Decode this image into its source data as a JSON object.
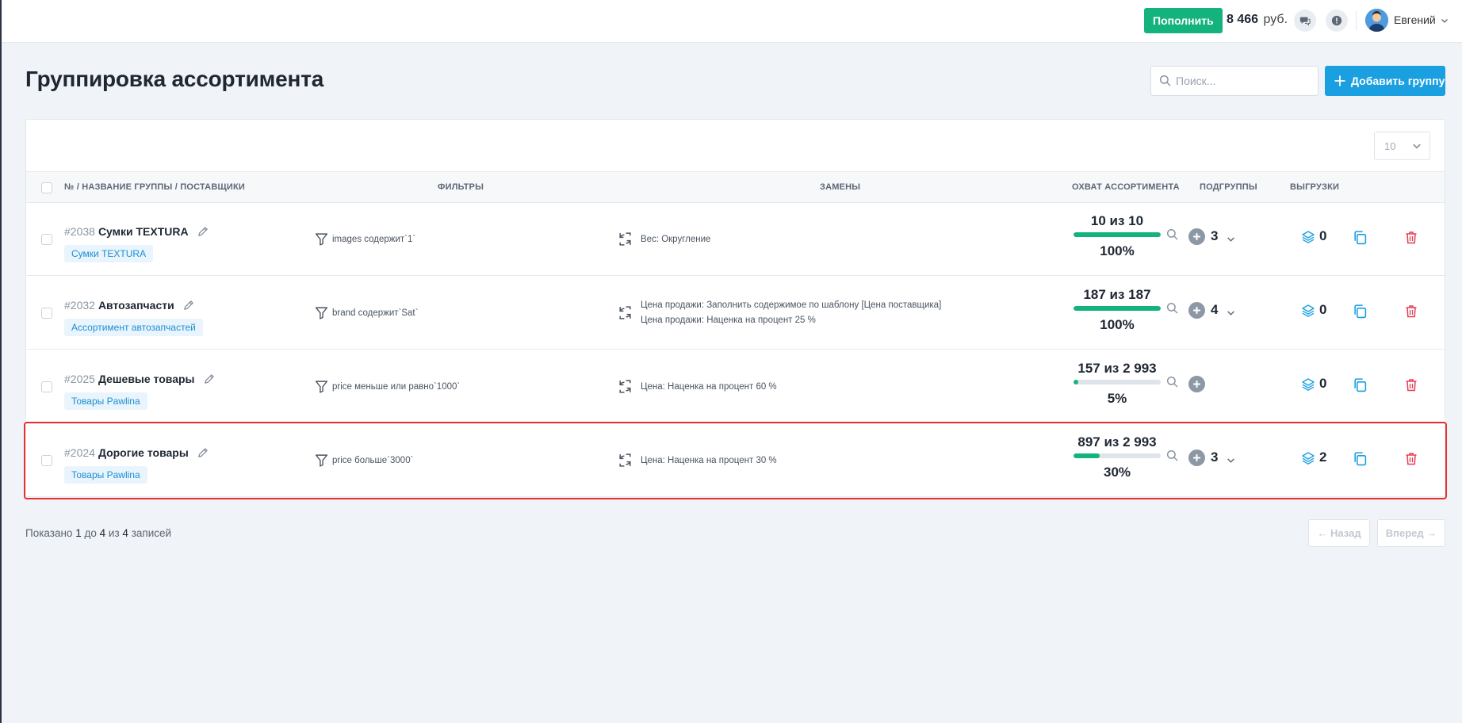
{
  "topbar": {
    "topup_label": "Пополнить",
    "balance_amount": "8 466",
    "balance_currency": "руб.",
    "user_name": "Евгений"
  },
  "page": {
    "title": "Группировка ассортимента",
    "search_placeholder": "Поиск...",
    "add_group_label": "Добавить группу",
    "per_page": "10"
  },
  "table": {
    "headers": {
      "name": "№ / НАЗВАНИЕ ГРУППЫ / ПОСТАВЩИКИ",
      "filters": "ФИЛЬТРЫ",
      "replacements": "ЗАМЕНЫ",
      "coverage": "ОХВАТ АССОРТИМЕНТА",
      "subgroups": "ПОДГРУППЫ",
      "exports": "ВЫГРУЗКИ"
    },
    "rows": [
      {
        "number": "#2038",
        "name": "Сумки TEXTURA",
        "supplier": "Сумки TEXTURA",
        "filter": "images содержит`1`",
        "replacements": [
          "Вес: Округление"
        ],
        "coverage_count": "10 из 10",
        "coverage_percent": "100%",
        "coverage_fraction": 1.0,
        "subgroups": "3",
        "exports": "0"
      },
      {
        "number": "#2032",
        "name": "Автозапчасти",
        "supplier": "Ассортимент автозапчастей",
        "filter": "brand содержит`Sat`",
        "replacements": [
          "Цена продажи: Заполнить содержимое по шаблону [Цена поставщика]",
          "Цена продажи: Наценка на процент 25 %"
        ],
        "coverage_count": "187 из 187",
        "coverage_percent": "100%",
        "coverage_fraction": 1.0,
        "subgroups": "4",
        "exports": "0"
      },
      {
        "number": "#2025",
        "name": "Дешевые товары",
        "supplier": "Товары Pawlina",
        "filter": "price меньше или равно`1000`",
        "replacements": [
          "Цена: Наценка на процент 60 %"
        ],
        "coverage_count": "157 из 2 993",
        "coverage_percent": "5%",
        "coverage_fraction": 0.05,
        "subgroups": "",
        "exports": "0"
      },
      {
        "number": "#2024",
        "name": "Дорогие товары",
        "supplier": "Товары Pawlina",
        "filter": "price больше`3000`",
        "replacements": [
          "Цена: Наценка на процент 30 %"
        ],
        "coverage_count": "897 из 2 993",
        "coverage_percent": "30%",
        "coverage_fraction": 0.3,
        "subgroups": "3",
        "exports": "2"
      }
    ]
  },
  "footer": {
    "shown_prefix": "Показано",
    "from": "1",
    "to_word": "до",
    "to": "4",
    "of_word": "из",
    "total": "4",
    "records_word": "записей",
    "prev_label": "← Назад",
    "next_label": "Вперед →"
  },
  "colors": {
    "accent_green": "#14b37d",
    "accent_blue": "#1a9fe0",
    "danger_red": "#e53030",
    "tag_blue": "#1a8fd4"
  }
}
